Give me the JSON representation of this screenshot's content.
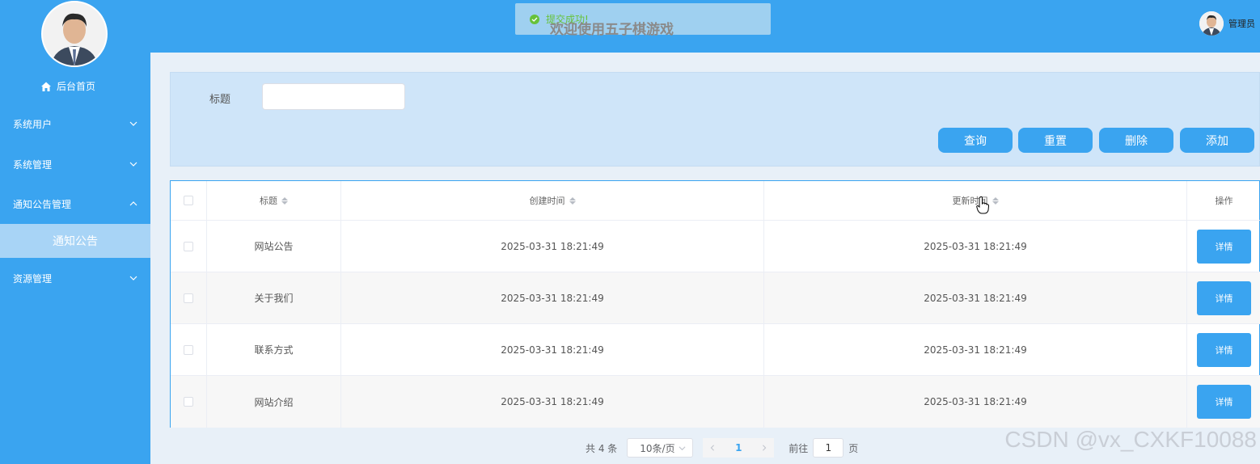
{
  "sidebar": {
    "home_label": "后台首页",
    "menu": [
      {
        "label": "系统用户"
      },
      {
        "label": "系统管理"
      },
      {
        "label": "通知公告管理"
      },
      {
        "label": "资源管理"
      }
    ],
    "active_submenu": "通知公告"
  },
  "header": {
    "toast": "提交成功!",
    "welcome": "欢迎使用五子棋游戏",
    "user_name": "管理员"
  },
  "search": {
    "label": "标题",
    "value": "",
    "buttons": {
      "query": "查询",
      "reset": "重置",
      "delete": "删除",
      "add": "添加"
    }
  },
  "table": {
    "columns": {
      "title": "标题",
      "created": "创建时间",
      "updated": "更新时间",
      "ops": "操作"
    },
    "rows": [
      {
        "title": "网站公告",
        "created": "2025-03-31 18:21:49",
        "updated": "2025-03-31 18:21:49",
        "action": "详情"
      },
      {
        "title": "关于我们",
        "created": "2025-03-31 18:21:49",
        "updated": "2025-03-31 18:21:49",
        "action": "详情"
      },
      {
        "title": "联系方式",
        "created": "2025-03-31 18:21:49",
        "updated": "2025-03-31 18:21:49",
        "action": "详情"
      },
      {
        "title": "网站介绍",
        "created": "2025-03-31 18:21:49",
        "updated": "2025-03-31 18:21:49",
        "action": "详情"
      }
    ]
  },
  "pagination": {
    "total": "共 4 条",
    "page_size": "10条/页",
    "current": "1",
    "goto_prefix": "前往",
    "goto_value": "1",
    "goto_suffix": "页"
  },
  "watermark": "CSDN @vx_CXKF10088",
  "colors": {
    "accent": "#3aa4f0",
    "panel": "#cfe5f9",
    "success": "#67c23a"
  }
}
